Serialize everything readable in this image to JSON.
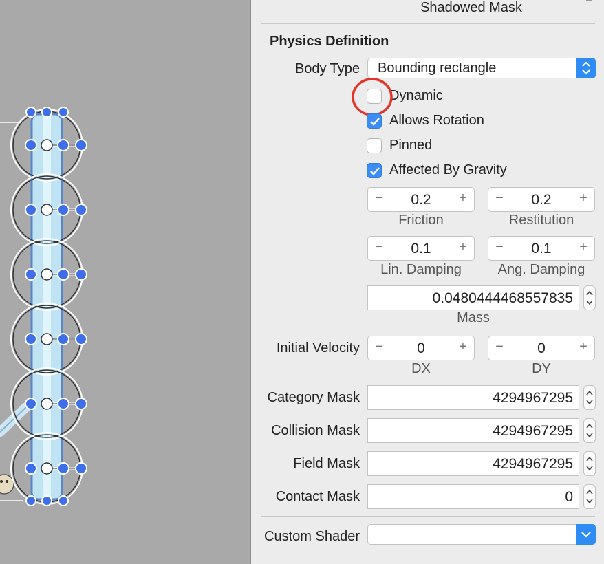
{
  "inspector": {
    "shadowed_mask_label": "Shadowed Mask",
    "section_title": "Physics Definition",
    "body_type": {
      "label": "Body Type",
      "value": "Bounding rectangle"
    },
    "checkboxes": [
      {
        "label": "Dynamic",
        "checked": false
      },
      {
        "label": "Allows Rotation",
        "checked": true
      },
      {
        "label": "Pinned",
        "checked": false
      },
      {
        "label": "Affected By Gravity",
        "checked": true
      }
    ],
    "friction": {
      "label": "Friction",
      "value": "0.2"
    },
    "restitution": {
      "label": "Restitution",
      "value": "0.2"
    },
    "lin_damping": {
      "label": "Lin. Damping",
      "value": "0.1"
    },
    "ang_damping": {
      "label": "Ang. Damping",
      "value": "0.1"
    },
    "mass": {
      "label": "Mass",
      "value": "0.0480444468557835"
    },
    "initial_velocity": {
      "label": "Initial Velocity",
      "dx": {
        "label": "DX",
        "value": "0"
      },
      "dy": {
        "label": "DY",
        "value": "0"
      }
    },
    "category_mask": {
      "label": "Category Mask",
      "value": "4294967295"
    },
    "collision_mask": {
      "label": "Collision Mask",
      "value": "4294967295"
    },
    "field_mask": {
      "label": "Field Mask",
      "value": "4294967295"
    },
    "contact_mask": {
      "label": "Contact Mask",
      "value": "0"
    },
    "custom_shader": {
      "label": "Custom Shader",
      "value": ""
    },
    "stepper_minus": "−",
    "stepper_plus": "+"
  },
  "colors": {
    "canvas_bg": "#a9a9a9",
    "inspector_bg": "#ececec",
    "accent_blue": "#2f8cf5",
    "highlight_red": "#e5332a"
  },
  "icons": [
    "checkmark-icon",
    "popup-arrows-icon",
    "chevron-down-icon",
    "stepper-updown-icon",
    "highlight-circle"
  ]
}
